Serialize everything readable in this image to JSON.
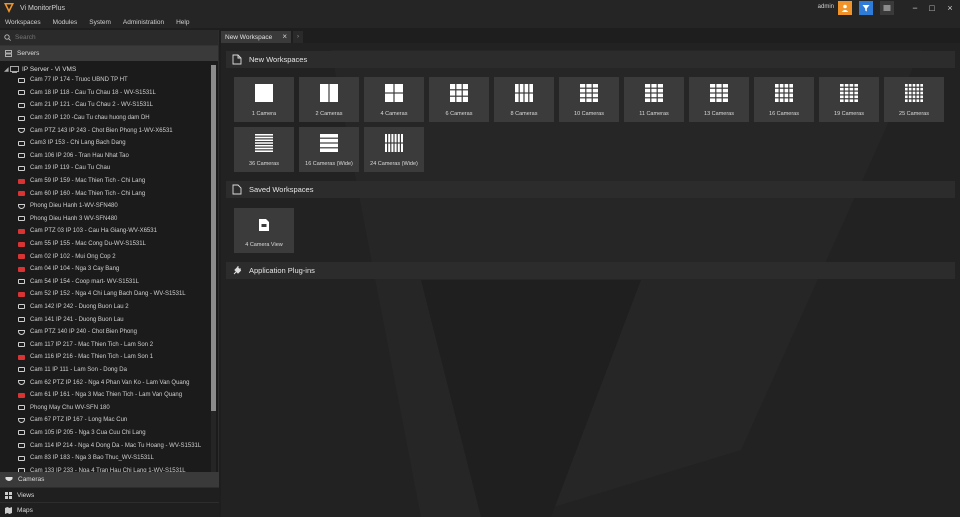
{
  "app": {
    "title": "Vi MonitorPlus",
    "user": "admin"
  },
  "menu": [
    "Workspaces",
    "Modules",
    "System",
    "Administration",
    "Help"
  ],
  "sidebar": {
    "search_placeholder": "Search",
    "servers_label": "Servers",
    "root_label": "IP Server - Vi VMS",
    "cameras_label": "Cameras",
    "views_label": "Views",
    "maps_label": "Maps",
    "items": [
      {
        "label": "Cam 77 IP 174 - Truoc UBND TP HT",
        "status": "ok"
      },
      {
        "label": "Cam 18 IP 118 - Cau Tu Chau 18 - WV-S1531L",
        "status": "ok"
      },
      {
        "label": "Cam 21 IP 121 - Cau Tu Chau 2 - WV-S1531L",
        "status": "ok"
      },
      {
        "label": "Cam 20 IP 120 -Cau Tu chau huong dam DH",
        "status": "ok"
      },
      {
        "label": "Cam PTZ 143 IP 243 - Chot Bien Phong 1-WV-X6531",
        "status": "ptz"
      },
      {
        "label": "Cam3 IP 153 - Chi Lang Bach Dang",
        "status": "ok"
      },
      {
        "label": "Cam 106 IP 206 - Tran Hau Nhat Tao",
        "status": "ok"
      },
      {
        "label": "Cam 19 IP 119 - Cau Tu Chau",
        "status": "ok"
      },
      {
        "label": "Cam 59 IP 159 - Mac Thien Tich - Chi Lang",
        "status": "err"
      },
      {
        "label": "Cam 60 IP 160 - Mac Thien Tich - Chi Lang",
        "status": "err"
      },
      {
        "label": "Phong Dieu Hanh 1-WV-SFN480",
        "status": "ptz"
      },
      {
        "label": "Phong Dieu Hanh 3 WV-SFN480",
        "status": "ok"
      },
      {
        "label": "Cam PTZ 03 IP 103 - Cau Ha Giang-WV-X6531",
        "status": "err"
      },
      {
        "label": "Cam 55 IP 155 - Mac Cong Du-WV-S1531L",
        "status": "err"
      },
      {
        "label": "Cam 02 IP 102 - Mui Ong Cop 2",
        "status": "err"
      },
      {
        "label": "Cam 04 IP 104 - Nga 3 Cay Bang",
        "status": "err"
      },
      {
        "label": "Cam 54 IP 154 - Coop mart- WV-S1531L",
        "status": "ok"
      },
      {
        "label": "Cam 52 IP 152 - Nga 4 Chi Lang Bach Dang - WV-S1531L",
        "status": "err"
      },
      {
        "label": "Cam 142 IP 242 - Duong Buon Lau 2",
        "status": "ok"
      },
      {
        "label": "Cam 141 IP 241 - Duong Buon Lau",
        "status": "ok"
      },
      {
        "label": "Cam PTZ 140 IP 240 - Chot Bien Phong",
        "status": "ptz"
      },
      {
        "label": "Cam 117 IP 217 - Mac Thien Tich - Lam Son 2",
        "status": "ok"
      },
      {
        "label": "Cam 116 IP 216 - Mac Thien Tich - Lam Son 1",
        "status": "err"
      },
      {
        "label": "Cam 11 IP 111 - Lam Son - Dong Da",
        "status": "ok"
      },
      {
        "label": "Cam 62 PTZ IP 162 - Nga 4 Phan Van Ko - Lam Van Quang",
        "status": "ptz"
      },
      {
        "label": "Cam 61 IP 161 - Nga 3 Mac Thien Tich - Lam Van Quang",
        "status": "err"
      },
      {
        "label": "Phong May Chu WV-SFN 180",
        "status": "ok"
      },
      {
        "label": "Cam 67 PTZ IP 167 - Long Mac Cun",
        "status": "ptz"
      },
      {
        "label": "Cam 105 IP 205 - Nga 3 Cua Cuu Chi Lang",
        "status": "ok"
      },
      {
        "label": "Cam 114 IP 214 - Nga 4 Dong Da - Mac Tu Hoang - WV-S1531L",
        "status": "ok"
      },
      {
        "label": "Cam 83 IP 183 - Nga 3 Bao Thuc_WV-S1531L",
        "status": "ok"
      },
      {
        "label": "Cam 133 IP 233 - Nga 4 Tran Hau Chi Lang 1-WV-S1531L",
        "status": "ok"
      }
    ]
  },
  "tabs": [
    {
      "label": "New Workspace"
    }
  ],
  "new_workspaces": {
    "title": "New Workspaces",
    "tiles": [
      {
        "label": "1 Camera",
        "layout": "1"
      },
      {
        "label": "2 Cameras",
        "layout": "2"
      },
      {
        "label": "4 Cameras",
        "layout": "4"
      },
      {
        "label": "6 Cameras",
        "layout": "6"
      },
      {
        "label": "8 Cameras",
        "layout": "8"
      },
      {
        "label": "10 Cameras",
        "layout": "10"
      },
      {
        "label": "11 Cameras",
        "layout": "11"
      },
      {
        "label": "13 Cameras",
        "layout": "13"
      },
      {
        "label": "16 Cameras",
        "layout": "16"
      },
      {
        "label": "19 Cameras",
        "layout": "19"
      },
      {
        "label": "25 Cameras",
        "layout": "25"
      },
      {
        "label": "36 Cameras",
        "layout": "36"
      },
      {
        "label": "16 Cameras (Wide)",
        "layout": "16w"
      },
      {
        "label": "24 Cameras (Wide)",
        "layout": "24w"
      }
    ]
  },
  "saved_workspaces": {
    "title": "Saved Workspaces",
    "tiles": [
      {
        "label": "4 Camera View"
      }
    ]
  },
  "plugins": {
    "title": "Application Plug-ins"
  },
  "colors": {
    "accent_orange": "#f0942a",
    "accent_blue": "#2f7bd8",
    "error_red": "#d93434"
  }
}
